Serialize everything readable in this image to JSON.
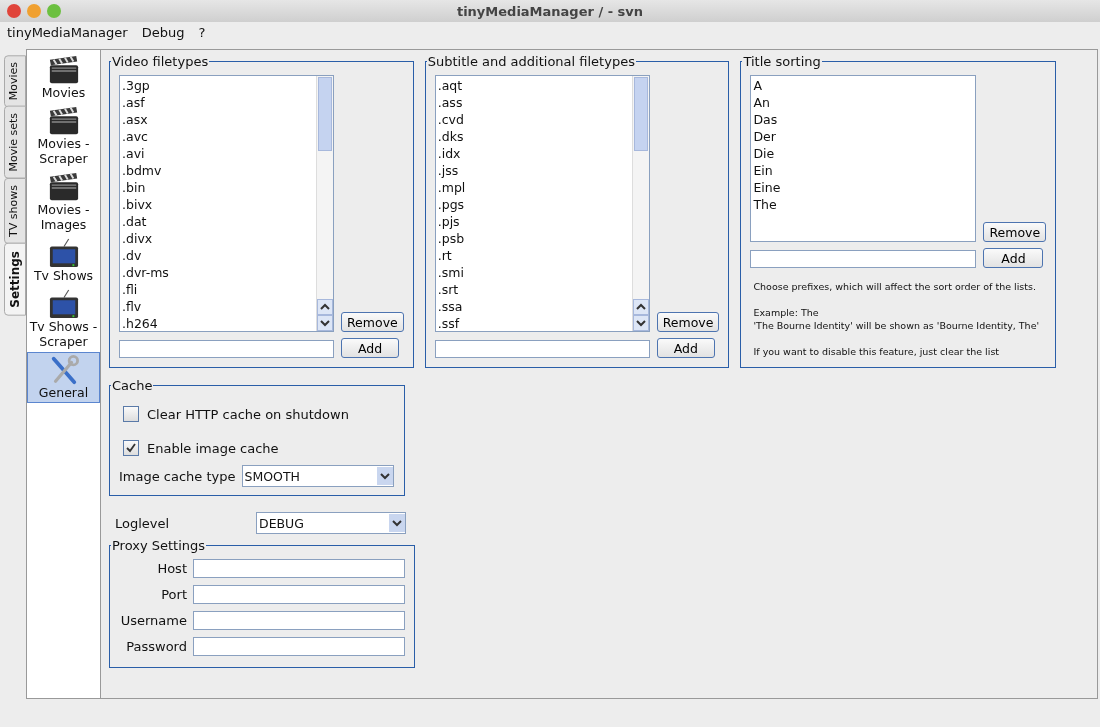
{
  "window": {
    "title": "tinyMediaManager / - svn"
  },
  "menu": [
    "tinyMediaManager",
    "Debug",
    "?"
  ],
  "tabs": [
    {
      "label": "Movies",
      "selected": false
    },
    {
      "label": "Movie sets",
      "selected": false
    },
    {
      "label": "TV shows",
      "selected": false
    },
    {
      "label": "Settings",
      "selected": true
    }
  ],
  "nav": [
    {
      "label": "Movies",
      "kind": "clapper",
      "selected": false
    },
    {
      "label": "Movies - Scraper",
      "kind": "clapper",
      "selected": false
    },
    {
      "label": "Movies - Images",
      "kind": "clapper",
      "selected": false
    },
    {
      "label": "Tv Shows",
      "kind": "tv",
      "selected": false
    },
    {
      "label": "Tv Shows - Scraper",
      "kind": "tv",
      "selected": false
    },
    {
      "label": "General",
      "kind": "tools",
      "selected": true
    }
  ],
  "filetype_groups": [
    {
      "title": "Video filetypes",
      "items": [
        ".3gp",
        ".asf",
        ".asx",
        ".avc",
        ".avi",
        ".bdmv",
        ".bin",
        ".bivx",
        ".dat",
        ".divx",
        ".dv",
        ".dvr-ms",
        ".fli",
        ".flv",
        ".h264"
      ],
      "remove": "Remove",
      "add": "Add"
    },
    {
      "title": "Subtitle and additional filetypes",
      "items": [
        ".aqt",
        ".ass",
        ".cvd",
        ".dks",
        ".idx",
        ".jss",
        ".mpl",
        ".pgs",
        ".pjs",
        ".psb",
        ".rt",
        ".smi",
        ".srt",
        ".ssa",
        ".ssf"
      ],
      "remove": "Remove",
      "add": "Add"
    }
  ],
  "title_sorting": {
    "title": "Title sorting",
    "items": [
      "A",
      "An",
      "Das",
      "Der",
      "Die",
      "Ein",
      "Eine",
      "The"
    ],
    "remove": "Remove",
    "add": "Add",
    "help": [
      "Choose prefixes, which will affect the sort order of the lists.",
      "Example: The",
      "'The Bourne Identity' will be shown as 'Bourne Identity, The'",
      "If you want to disable this feature, just clear the list"
    ]
  },
  "cache": {
    "title": "Cache",
    "options": [
      {
        "label": "Clear HTTP cache on shutdown",
        "checked": false
      },
      {
        "label": "Enable image cache",
        "checked": true
      }
    ],
    "type_label": "Image cache type",
    "type_value": "SMOOTH"
  },
  "loglevel": {
    "label": "Loglevel",
    "value": "DEBUG"
  },
  "proxy": {
    "title": "Proxy Settings",
    "fields": [
      "Host",
      "Port",
      "Username",
      "Password"
    ]
  }
}
